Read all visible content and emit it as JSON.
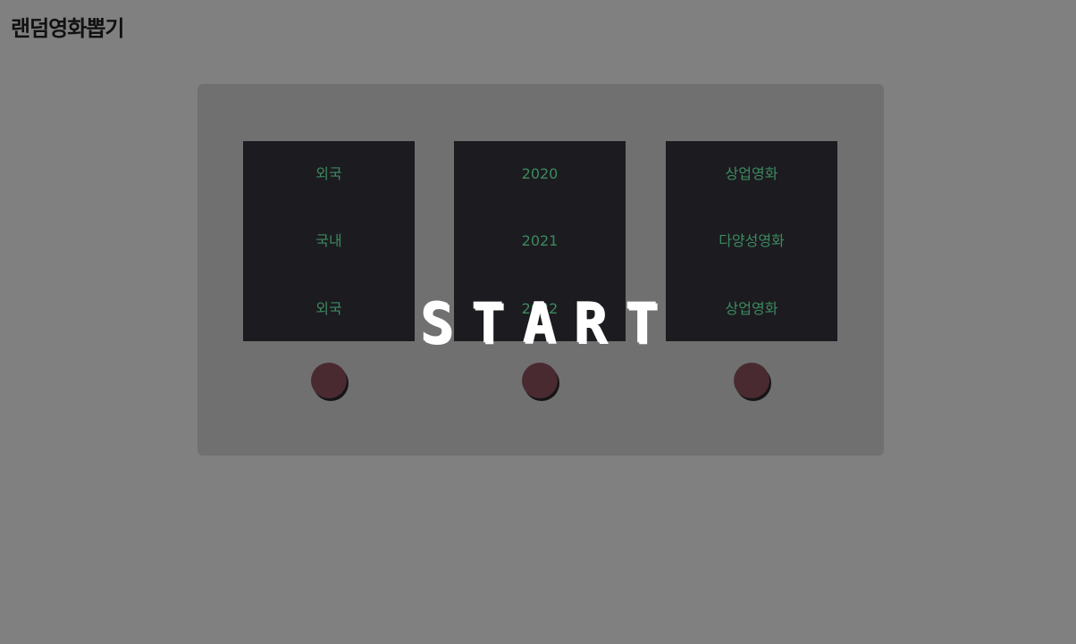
{
  "title": "랜덤영화뽑기",
  "reels": [
    {
      "items": [
        "외국",
        "국내",
        "외국"
      ]
    },
    {
      "items": [
        "2020",
        "2021",
        "2022"
      ]
    },
    {
      "items": [
        "상업영화",
        "다양성영화",
        "상업영화"
      ]
    }
  ],
  "start_label": "START",
  "colors": {
    "background": "#808080",
    "machine": "#707070",
    "reel": "#1c1b20",
    "reel_text": "#3c8a5e",
    "stop_button": "#4a2a31",
    "start_text": "#ffffff"
  }
}
